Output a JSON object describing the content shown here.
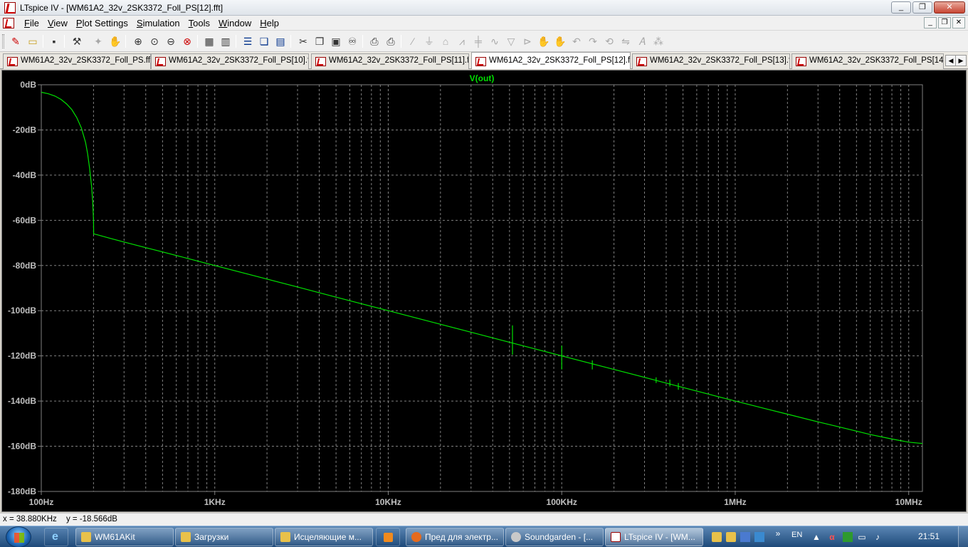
{
  "window": {
    "title": "LTspice IV - [WM61A2_32v_2SK3372_Foll_PS[12].fft]",
    "controls": [
      "_",
      "❐",
      "✕"
    ]
  },
  "menu": {
    "items": [
      "File",
      "View",
      "Plot Settings",
      "Simulation",
      "Tools",
      "Window",
      "Help"
    ],
    "mdi_controls": [
      "_",
      "❐",
      "✕"
    ]
  },
  "tabs": [
    {
      "label": "WM61A2_32v_2SK3372_Foll_PS.fft",
      "active": false
    },
    {
      "label": "WM61A2_32v_2SK3372_Foll_PS[10].fft",
      "active": false
    },
    {
      "label": "WM61A2_32v_2SK3372_Foll_PS[11].fft",
      "active": false
    },
    {
      "label": "WM61A2_32v_2SK3372_Foll_PS[12].fft",
      "active": true
    },
    {
      "label": "WM61A2_32v_2SK3372_Foll_PS[13].fft",
      "active": false
    },
    {
      "label": "WM61A2_32v_2SK3372_Foll_PS[14].fft",
      "active": false
    }
  ],
  "colors": {
    "trace": "#00e000",
    "plot_bg": "#000000",
    "grid": "#808080",
    "axis_text": "#c0c0c0",
    "title_text": "#00e000"
  },
  "chart_data": {
    "type": "line",
    "title": "V(out)",
    "x_scale": "log",
    "xlim": [
      100,
      12000000
    ],
    "ylim": [
      -180,
      0
    ],
    "x_unit": "Hz",
    "y_unit": "dB",
    "grid": true,
    "x_ticks": [
      {
        "value": 100,
        "label": "100Hz"
      },
      {
        "value": 1000,
        "label": "1KHz"
      },
      {
        "value": 10000,
        "label": "10KHz"
      },
      {
        "value": 100000,
        "label": "100KHz"
      },
      {
        "value": 1000000,
        "label": "1MHz"
      },
      {
        "value": 10000000,
        "label": "10MHz"
      }
    ],
    "y_ticks": [
      {
        "value": 0,
        "label": "0dB"
      },
      {
        "value": -20,
        "label": "-20dB"
      },
      {
        "value": -40,
        "label": "-40dB"
      },
      {
        "value": -60,
        "label": "-60dB"
      },
      {
        "value": -80,
        "label": "-80dB"
      },
      {
        "value": -100,
        "label": "-100dB"
      },
      {
        "value": -120,
        "label": "-120dB"
      },
      {
        "value": -140,
        "label": "-140dB"
      },
      {
        "value": -160,
        "label": "-160dB"
      },
      {
        "value": -180,
        "label": "-180dB"
      }
    ],
    "series": [
      {
        "name": "V(out)",
        "x": [
          100,
          110,
          120,
          130,
          140,
          150,
          160,
          170,
          180,
          185,
          190,
          195,
          198,
          200,
          200.5,
          210,
          250,
          300,
          400,
          500,
          700,
          1000,
          2000,
          3000,
          5000,
          7000,
          10000,
          20000,
          30000,
          50000,
          70000,
          100000,
          200000,
          300000,
          500000,
          700000,
          1000000,
          1500000,
          2000000,
          3000000,
          4000000,
          5000000,
          6000000,
          8000000,
          10000000,
          12000000
        ],
        "y": [
          -3.3,
          -4.0,
          -5.0,
          -6.5,
          -8.5,
          -11.0,
          -14.5,
          -19.0,
          -25.5,
          -30.5,
          -37.0,
          -45.0,
          -52.0,
          -60.0,
          -66.0,
          -66.4,
          -68.0,
          -69.6,
          -72.1,
          -74.0,
          -76.9,
          -80.0,
          -86.0,
          -89.5,
          -94.0,
          -96.9,
          -100.0,
          -106.0,
          -109.5,
          -114.0,
          -116.9,
          -120.0,
          -126.0,
          -129.5,
          -134.0,
          -136.9,
          -140.0,
          -143.4,
          -145.8,
          -149.2,
          -151.5,
          -153.3,
          -154.8,
          -156.8,
          -158.2,
          -158.8
        ]
      }
    ],
    "spikes": [
      {
        "x": 52000,
        "y_top": -106.5,
        "y_bottom": -119.5
      },
      {
        "x": 100000,
        "y_top": -115.5,
        "y_bottom": -126.0
      },
      {
        "x": 150000,
        "y_top": -122.0,
        "y_bottom": -126.0
      },
      {
        "x": 350000,
        "y_top": -129.5,
        "y_bottom": -132.0
      },
      {
        "x": 420000,
        "y_top": -130.5,
        "y_bottom": -133.5
      },
      {
        "x": 470000,
        "y_top": -132.0,
        "y_bottom": -135.0
      }
    ]
  },
  "status": {
    "x_readout": "x = 38.880KHz",
    "y_readout": "y = -18.566dB"
  },
  "taskbar": {
    "tasks": [
      {
        "label": "WM61AKit",
        "icon_color": "#e8c14a"
      },
      {
        "label": "Загрузки",
        "icon_color": "#e8c14a"
      },
      {
        "label": "Исцеляющие м...",
        "icon_color": "#e8c14a"
      },
      {
        "label": "Пред для электр...",
        "icon_color": "#e66b1e"
      },
      {
        "label": "Soundgarden - [...",
        "icon_color": "#c9c9c9"
      },
      {
        "label": "LTspice IV - [WM...",
        "icon_color": "#cc2222",
        "active": true
      }
    ],
    "lang": "EN",
    "clock": "21:51"
  }
}
